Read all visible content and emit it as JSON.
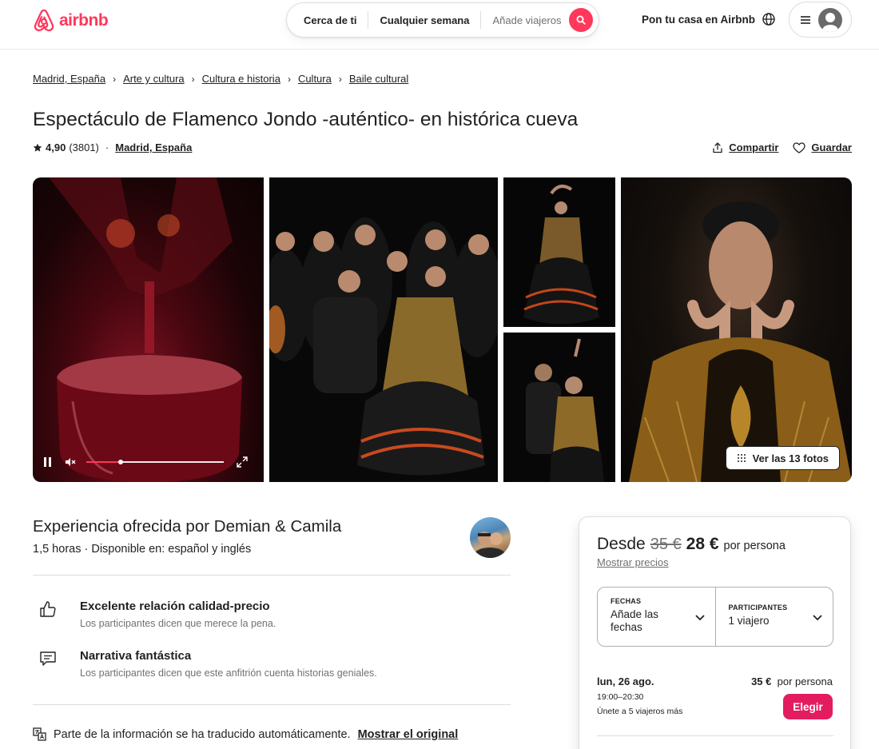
{
  "header": {
    "logo_text": "airbnb",
    "search": {
      "where": "Cerca de ti",
      "when": "Cualquier semana",
      "who": "Añade viajeros"
    },
    "host_link": "Pon tu casa en Airbnb",
    "accent_color": "#ff385c"
  },
  "breadcrumb": [
    "Madrid, España",
    "Arte y cultura",
    "Cultura e historia",
    "Cultura",
    "Baile cultural"
  ],
  "listing": {
    "title": "Espectáculo de Flamenco Jondo -auténtico- en histórica cueva",
    "rating": "4,90",
    "reviews": "(3801)",
    "separator": "·",
    "location": "Madrid, España",
    "share_label": "Compartir",
    "save_label": "Guardar"
  },
  "gallery": {
    "show_all_label": "Ver las 13 fotos",
    "video_progress": 0.25
  },
  "host": {
    "title": "Experiencia ofrecida por Demian & Camila",
    "subtitle": "1,5 horas · Disponible en: español y inglés"
  },
  "features": [
    {
      "icon": "thumbs-up-icon",
      "title": "Excelente relación calidad-precio",
      "subtitle": "Los participantes dicen que merece la pena."
    },
    {
      "icon": "chat-bubble-icon",
      "title": "Narrativa fantástica",
      "subtitle": "Los participantes dicen que este anfitrión cuenta historias geniales."
    }
  ],
  "translation": {
    "text": "Parte de la información se ha traducido automáticamente.",
    "link": "Mostrar el original"
  },
  "booking": {
    "from_label": "Desde",
    "old_price": "35 €",
    "new_price": "28 €",
    "per_person": "por persona",
    "show_prices": "Mostrar precios",
    "dates_label": "FECHAS",
    "dates_value": "Añade las fechas",
    "guests_label": "PARTICIPANTES",
    "guests_value": "1 viajero",
    "slot": {
      "date": "lun, 26 ago.",
      "time": "19:00–20:30",
      "note": "Únete a 5 viajeros más",
      "price": "35 €",
      "per_person": "por persona",
      "cta": "Elegir"
    },
    "cta_color": "#e31c5f"
  }
}
